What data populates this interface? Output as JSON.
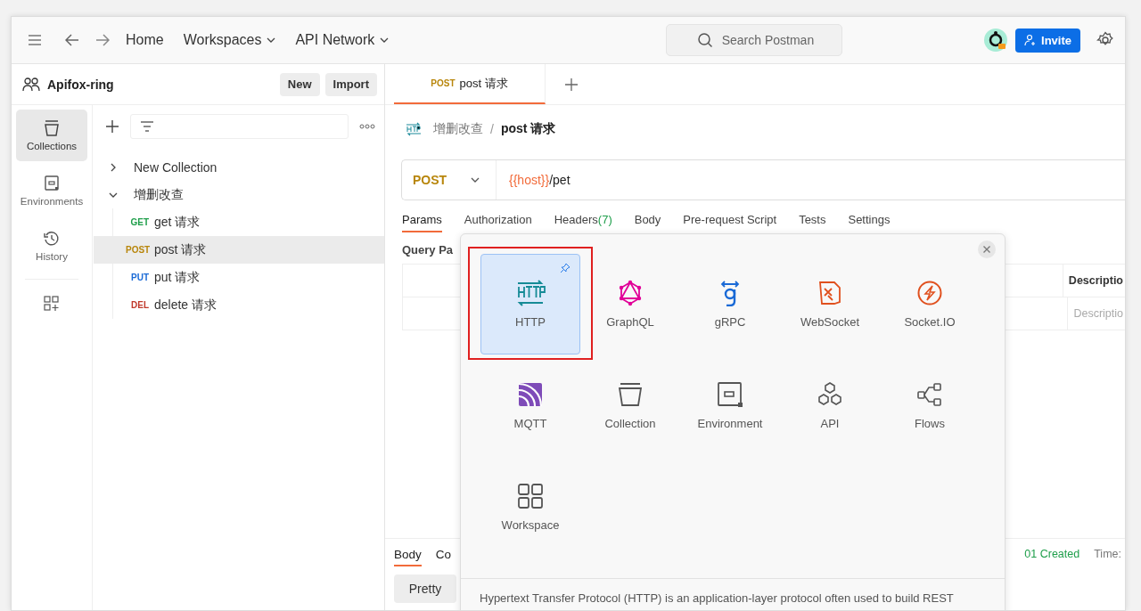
{
  "topbar": {
    "nav": [
      {
        "label": "Home",
        "dropdown": false
      },
      {
        "label": "Workspaces",
        "dropdown": true
      },
      {
        "label": "API Network",
        "dropdown": true
      }
    ],
    "search": {
      "placeholder": "Search Postman"
    },
    "invite": "Invite"
  },
  "workspace": {
    "name": "Apifox-ring",
    "buttons": [
      "New",
      "Import"
    ]
  },
  "rail": [
    {
      "label": "Collections",
      "selected": true
    },
    {
      "label": "Environments",
      "selected": false
    },
    {
      "label": "History",
      "selected": false
    }
  ],
  "tree": [
    {
      "name": "New Collection",
      "expanded": false
    },
    {
      "name": "增删改查",
      "expanded": true,
      "children": [
        {
          "method": "GET",
          "name": "get 请求",
          "color": "#1e9e4a",
          "selected": false
        },
        {
          "method": "POST",
          "name": "post 请求",
          "color": "#b8860b",
          "selected": true
        },
        {
          "method": "PUT",
          "name": "put 请求",
          "color": "#1a6ad6",
          "selected": false
        },
        {
          "method": "DEL",
          "name": "delete 请求",
          "color": "#c0392b",
          "selected": false
        }
      ]
    }
  ],
  "tabs": [
    {
      "method": "POST",
      "title": "post 请求",
      "color": "#b8860b",
      "selected": true
    }
  ],
  "breadcrumb": {
    "parent": "增删改查",
    "separator": "/",
    "current": "post 请求"
  },
  "url": {
    "method": "POST",
    "variable": "{{host}}",
    "path": "/pet"
  },
  "request_tabs": [
    {
      "label": "Params",
      "selected": true
    },
    {
      "label": "Authorization",
      "selected": false
    },
    {
      "label": "Headers",
      "count": "(7)",
      "selected": false
    },
    {
      "label": "Body",
      "selected": false
    },
    {
      "label": "Pre-request Script",
      "selected": false
    },
    {
      "label": "Tests",
      "selected": false
    },
    {
      "label": "Settings",
      "selected": false
    }
  ],
  "query_label": "Query Pa",
  "params_table": {
    "header": "Descriptio",
    "placeholder": "Descriptio"
  },
  "response": {
    "tabs": [
      {
        "label": "Body",
        "selected": true
      },
      {
        "label": "Co",
        "selected": false
      }
    ],
    "status": "01 Created",
    "time": "Time:",
    "format": "Pretty"
  },
  "popup": {
    "items": [
      {
        "label": "HTTP",
        "selected": true,
        "pinned": true
      },
      {
        "label": "GraphQL",
        "selected": false,
        "pinned": false
      },
      {
        "label": "gRPC",
        "selected": false,
        "pinned": false
      },
      {
        "label": "WebSocket",
        "selected": false,
        "pinned": false
      },
      {
        "label": "Socket.IO",
        "selected": false,
        "pinned": false
      },
      {
        "label": "MQTT",
        "selected": false,
        "pinned": false
      },
      {
        "label": "Collection",
        "selected": false,
        "pinned": false
      },
      {
        "label": "Environment",
        "selected": false,
        "pinned": false
      },
      {
        "label": "API",
        "selected": false,
        "pinned": false
      },
      {
        "label": "Flows",
        "selected": false,
        "pinned": false
      },
      {
        "label": "Workspace",
        "selected": false,
        "pinned": false
      }
    ],
    "description": "Hypertext Transfer Protocol (HTTP) is an application-layer protocol often used to build REST"
  }
}
